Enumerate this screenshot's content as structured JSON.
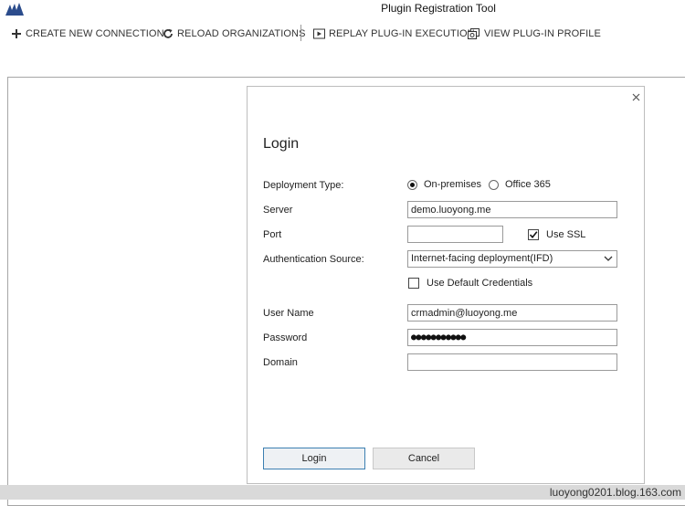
{
  "window": {
    "title": "Plugin Registration Tool"
  },
  "toolbar": {
    "create": "CREATE NEW CONNECTION",
    "reload": "RELOAD ORGANIZATIONS",
    "replay": "REPLAY PLUG-IN EXECUTION",
    "profile": "VIEW PLUG-IN PROFILE"
  },
  "dialog": {
    "title": "Login",
    "deployment_type": {
      "label": "Deployment Type:",
      "options": [
        "On-premises",
        "Office 365"
      ],
      "selected": "On-premises"
    },
    "server": {
      "label": "Server",
      "value": "demo.luoyong.me"
    },
    "port": {
      "label": "Port",
      "value": ""
    },
    "use_ssl": {
      "label": "Use SSL",
      "checked": true
    },
    "auth_source": {
      "label": "Authentication Source:",
      "value": "Internet-facing deployment(IFD)"
    },
    "default_credentials": {
      "label": "Use Default Credentials",
      "checked": false
    },
    "user_name": {
      "label": "User Name",
      "value": "crmadmin@luoyong.me"
    },
    "password": {
      "label": "Password",
      "masked": "●●●●●●●●●●●"
    },
    "domain": {
      "label": "Domain",
      "value": ""
    },
    "login_button": "Login",
    "cancel_button": "Cancel"
  },
  "watermark": "luoyong0201.blog.163.com",
  "colors": {
    "accent": "#3c7fb1",
    "logo": "#2b4c8c"
  },
  "icons": [
    "app-logo-icon",
    "plus-icon",
    "refresh-icon",
    "replay-icon",
    "profile-icon",
    "close-icon",
    "chevron-down-icon",
    "checkmark-icon"
  ]
}
